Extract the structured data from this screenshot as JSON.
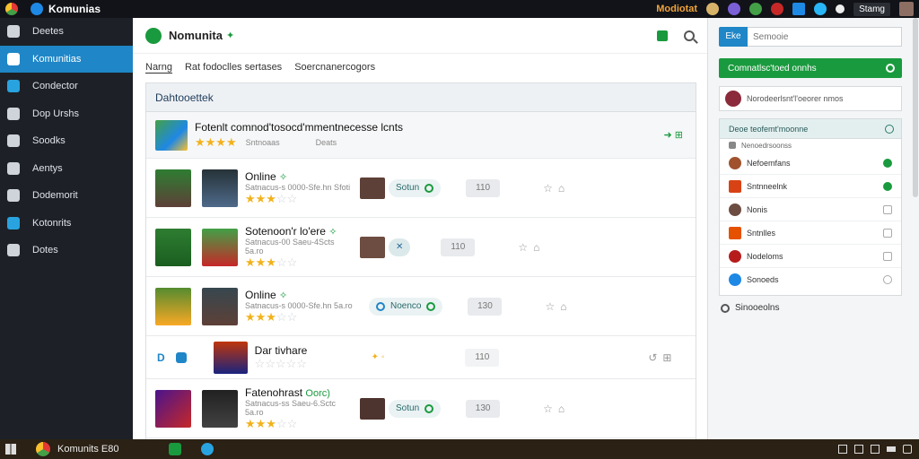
{
  "topbar": {
    "brand": "Komunias",
    "user_link": "Modiotat",
    "account_label": "Stamg"
  },
  "sidebar": {
    "items": [
      {
        "label": "Deetes",
        "active": false
      },
      {
        "label": "Komunitias",
        "active": true
      },
      {
        "label": "Condector",
        "active": false
      },
      {
        "label": "Dop Urshs",
        "active": false
      },
      {
        "label": "Soodks",
        "active": false
      },
      {
        "label": "Aentys",
        "active": false
      },
      {
        "label": "Dodemorit",
        "active": false
      },
      {
        "label": "Kotonrits",
        "active": false
      },
      {
        "label": "Dotes",
        "active": false
      }
    ]
  },
  "main": {
    "title": "Nomunita",
    "tabs": [
      "Narng",
      "Rat fodoclles sertases",
      "Soercnanercogors"
    ],
    "panel_title": "Dahtooettek",
    "highlight": {
      "title": "Fotenlt comnod'tosocd'mmentnecesse lcnts",
      "meta": "Sntnoaas",
      "meta2": "Deats"
    },
    "games": [
      {
        "name": "Online",
        "tag": "✧",
        "meta": "Satnacus-s 0000-Sfe.hn Sfoti",
        "stars": 3,
        "status": "Sotun",
        "count": "110"
      },
      {
        "name": "Sotenoon'r lo'ere",
        "tag": "✧",
        "meta": "Satnacus-00 Saeu-4Scts 5a.ro",
        "stars": 3,
        "status": "",
        "count": "110"
      },
      {
        "name": "Online",
        "tag": "✧",
        "meta": "Satnacus-s 0000-Sfe.hn 5a.ro",
        "stars": 3,
        "status": "Noenco",
        "count": "130"
      },
      {
        "name": "Dar tivhare",
        "tag": "",
        "meta": "",
        "stars": 0,
        "status": "",
        "count": "110"
      },
      {
        "name": "Fatenohrast",
        "tag": "Oorc)",
        "meta": "Satnacus-ss Saeu-6.Sctc 5a.ro",
        "stars": 3,
        "status": "Sotun",
        "count": "130"
      }
    ]
  },
  "right": {
    "search_btn": "Eke",
    "search_placeholder": "Semooie",
    "cta": "Comnatlsc'toed onnhs",
    "notice": "Norodeerlsnt'l'oeorer nmos",
    "friends_title": "Deoe teofemt'moonne",
    "friends_sub": "Nenoedrsoonss",
    "friends": [
      {
        "name": "Nefoemfans",
        "online": true
      },
      {
        "name": "Sntnneelnk",
        "online": true
      },
      {
        "name": "Nonis",
        "online": false
      },
      {
        "name": "Sntnlles",
        "online": false
      },
      {
        "name": "Nodeloms",
        "online": false
      },
      {
        "name": "Sonoeds",
        "online": false
      }
    ],
    "footer": "Sinooeolns"
  },
  "taskbar": {
    "app": "Komunits E80"
  },
  "colors": {
    "accent_blue": "#1f86c7",
    "accent_green": "#1a9a3e",
    "sidebar": "#1d2127"
  }
}
